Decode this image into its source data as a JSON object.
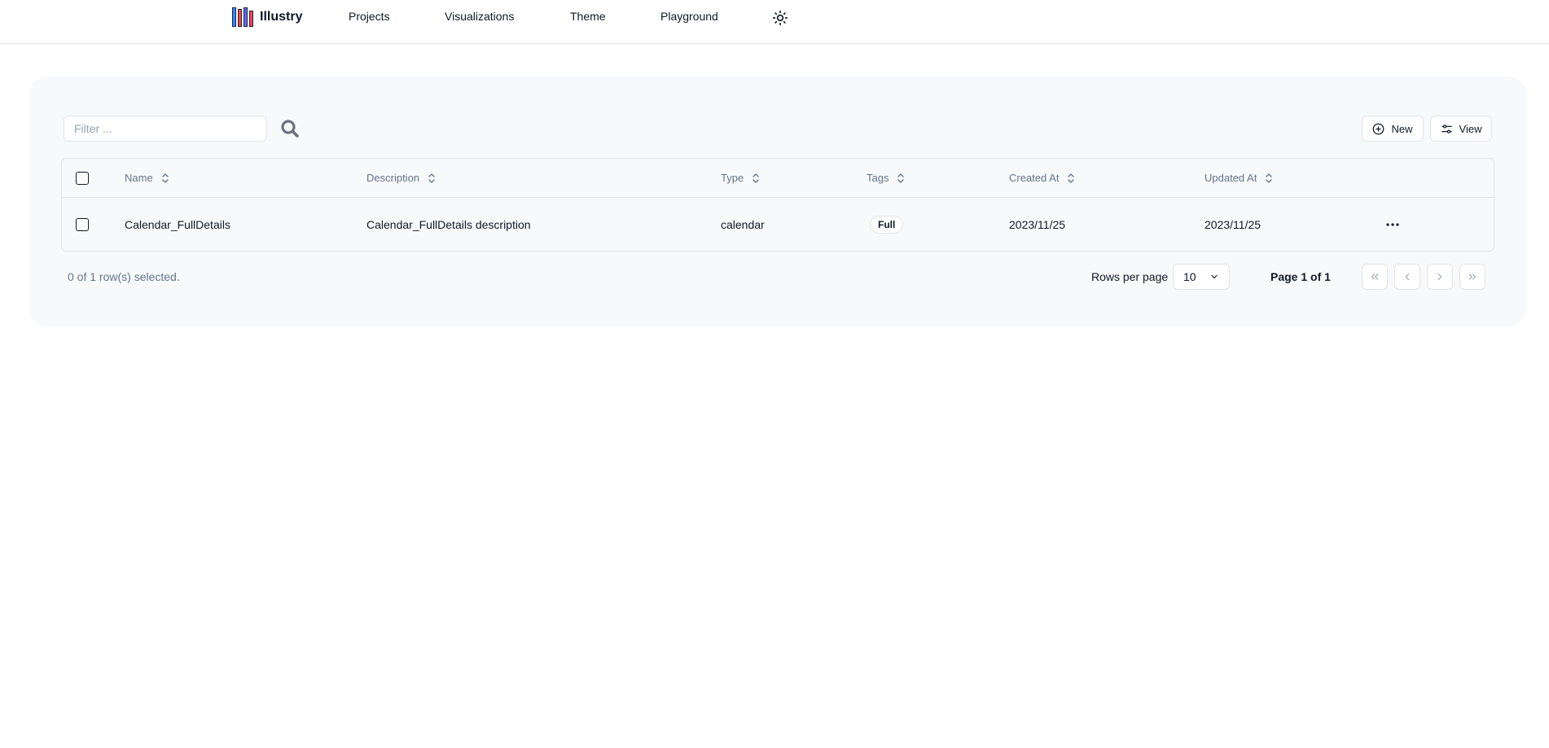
{
  "header": {
    "brand": "Illustry",
    "nav": [
      {
        "label": "Projects"
      },
      {
        "label": "Visualizations"
      },
      {
        "label": "Theme"
      },
      {
        "label": "Playground"
      }
    ],
    "theme_icon": "sun-icon",
    "logo_colors": [
      "#3b82f6",
      "#ef4444",
      "#6366f1",
      "#f43f5e"
    ]
  },
  "toolbar": {
    "filter_placeholder": "Filter ...",
    "filter_value": "",
    "search_icon": "search-icon",
    "new_label": "New",
    "view_label": "View"
  },
  "table": {
    "columns": [
      "Name",
      "Description",
      "Type",
      "Tags",
      "Created At",
      "Updated At"
    ],
    "rows": [
      {
        "name": "Calendar_FullDetails",
        "description": "Calendar_FullDetails description",
        "type": "calendar",
        "tags": "Full",
        "created_at": "2023/11/25",
        "updated_at": "2023/11/25"
      }
    ]
  },
  "footer": {
    "selected_text": "0 of 1 row(s) selected.",
    "rows_per_page_label": "Rows per page",
    "rows_per_page_value": "10",
    "page_text": "Page 1 of 1"
  }
}
